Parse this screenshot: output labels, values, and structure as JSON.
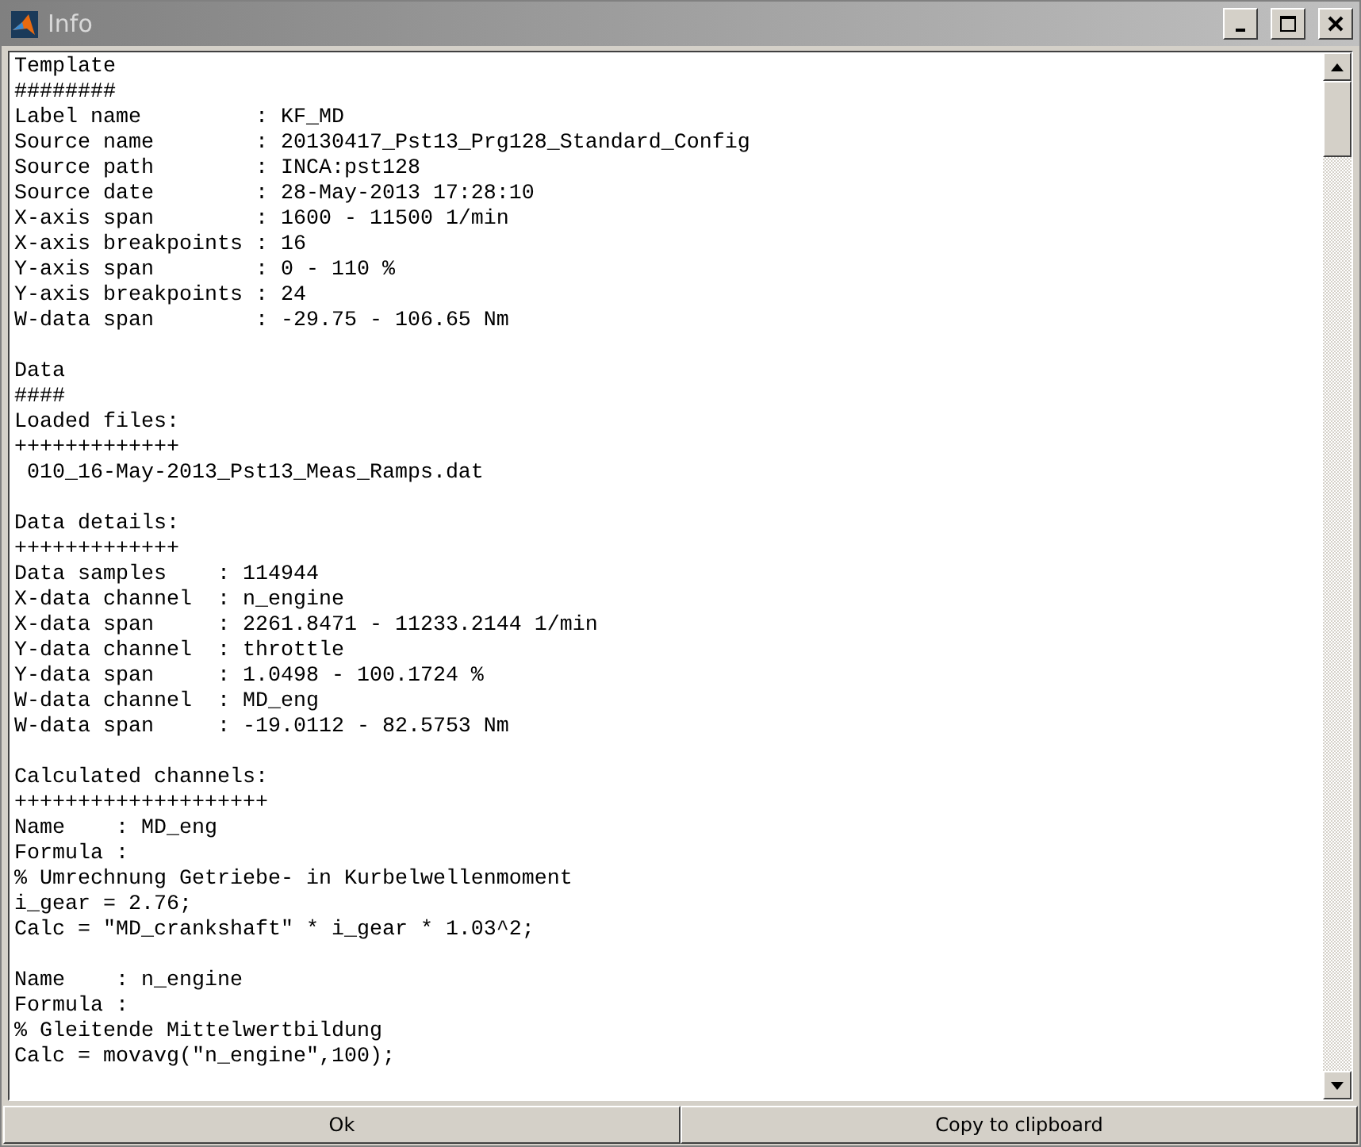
{
  "window": {
    "title": "Info"
  },
  "text_blocks": [
    {
      "lines": [
        "Template",
        "########",
        "Label name         : KF_MD",
        "Source name        : 20130417_Pst13_Prg128_Standard_Config",
        "Source path        : INCA:pst128",
        "Source date        : 28-May-2013 17:28:10",
        "X-axis span        : 1600 - 11500 1/min",
        "X-axis breakpoints : 16",
        "Y-axis span        : 0 - 110 %",
        "Y-axis breakpoints : 24",
        "W-data span        : -29.75 - 106.65 Nm"
      ]
    },
    {
      "lines": [
        "Data",
        "####",
        "Loaded files:",
        "+++++++++++++",
        " 010_16-May-2013_Pst13_Meas_Ramps.dat"
      ]
    },
    {
      "lines": [
        "Data details:",
        "+++++++++++++",
        "Data samples    : 114944",
        "X-data channel  : n_engine",
        "X-data span     : 2261.8471 - 11233.2144 1/min",
        "Y-data channel  : throttle",
        "Y-data span     : 1.0498 - 100.1724 %",
        "W-data channel  : MD_eng",
        "W-data span     : -19.0112 - 82.5753 Nm"
      ]
    },
    {
      "lines": [
        "Calculated channels:",
        "++++++++++++++++++++",
        "Name    : MD_eng",
        "Formula :",
        "% Umrechnung Getriebe- in Kurbelwellenmoment",
        "i_gear = 2.76;",
        "Calc = \"MD_crankshaft\" * i_gear * 1.03^2;"
      ]
    },
    {
      "lines": [
        "Name    : n_engine",
        "Formula :",
        "% Gleitende Mittelwertbildung",
        "Calc = movavg(\"n_engine\",100);"
      ]
    }
  ],
  "buttons": [
    "Ok",
    "Copy to clipboard"
  ]
}
